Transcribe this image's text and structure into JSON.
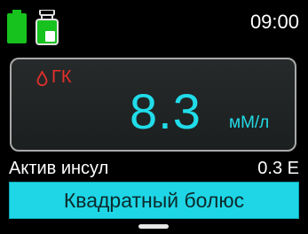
{
  "status": {
    "time": "09:00",
    "battery_icon": "battery-full-icon",
    "reservoir_icon": "insulin-reservoir-icon",
    "battery_color": "#17c21f"
  },
  "glucose": {
    "label": "ГК",
    "value": "8.3",
    "unit": "мМ/л",
    "label_color": "#e5302b",
    "value_color": "#20dce9",
    "icon": "blood-drop-icon"
  },
  "insulin_on_board": {
    "label": "Актив инсул",
    "value": "0.3 Е"
  },
  "action": {
    "label": "Квадратный болюс",
    "color": "#1ed6e6"
  }
}
